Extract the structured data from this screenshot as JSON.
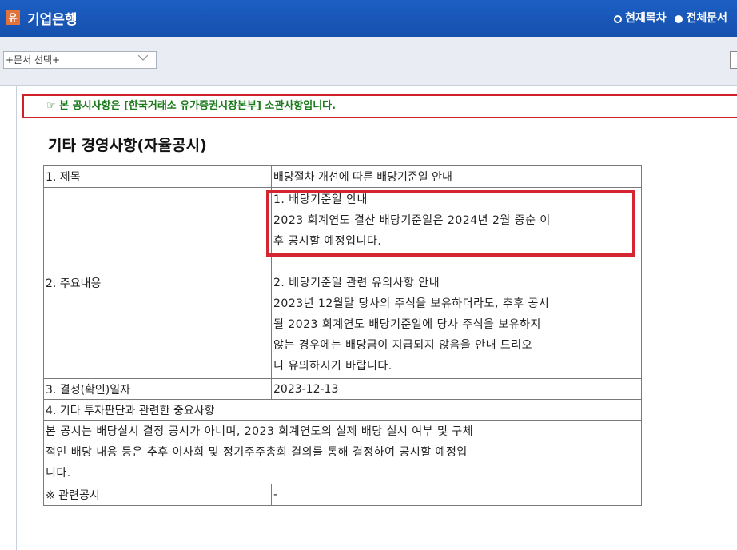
{
  "app": {
    "logo_char": "유",
    "title": "기업은행"
  },
  "view_toggle": {
    "current_label": "현재목차",
    "all_label": "전체문서"
  },
  "doc_select": {
    "placeholder": "+문서 선택+"
  },
  "notice": "☞ 본 공시사항은 [한국거래소 유가증권시장본부] 소관사항입니다.",
  "heading": "기타 경영사항(자율공시)",
  "table": {
    "r1_label": "1. 제목",
    "r1_value": "배당절차 개선에 따른 배당기준일 안내",
    "r2_label": "2. 주요내용",
    "r2_p1_l1": "1. 배당기준일 안내",
    "r2_p1_l2": "2023 회계연도 결산 배당기준일은 2024년 2월 중순 이",
    "r2_p1_l3": "후 공시할 예정입니다.",
    "r2_p2_l1": "2. 배당기준일 관련 유의사항 안내",
    "r2_p2_l2": "2023년 12월말 당사의 주식을 보유하더라도, 추후 공시",
    "r2_p2_l3": "될 2023 회계연도 배당기준일에 당사 주식을 보유하지",
    "r2_p2_l4": "않는 경우에는 배당금이 지급되지 않음을 안내 드리오",
    "r2_p2_l5": "니 유의하시기 바랍니다.",
    "r3_label": "3. 결정(확인)일자",
    "r3_value": "2023-12-13",
    "r4_label": "4. 기타 투자판단과 관련한 중요사항",
    "r5_l1": "본 공시는 배당실시 결정 공시가 아니며, 2023 회계연도의 실제 배당 실시 여부 및 구체",
    "r5_l2": "적인 배당 내용 등은 추후 이사회 및 정기주주총회 결의를 통해 결정하여 공시할 예정입",
    "r5_l3": "니다.",
    "r6_label": "※ 관련공시",
    "r6_value": "-"
  }
}
